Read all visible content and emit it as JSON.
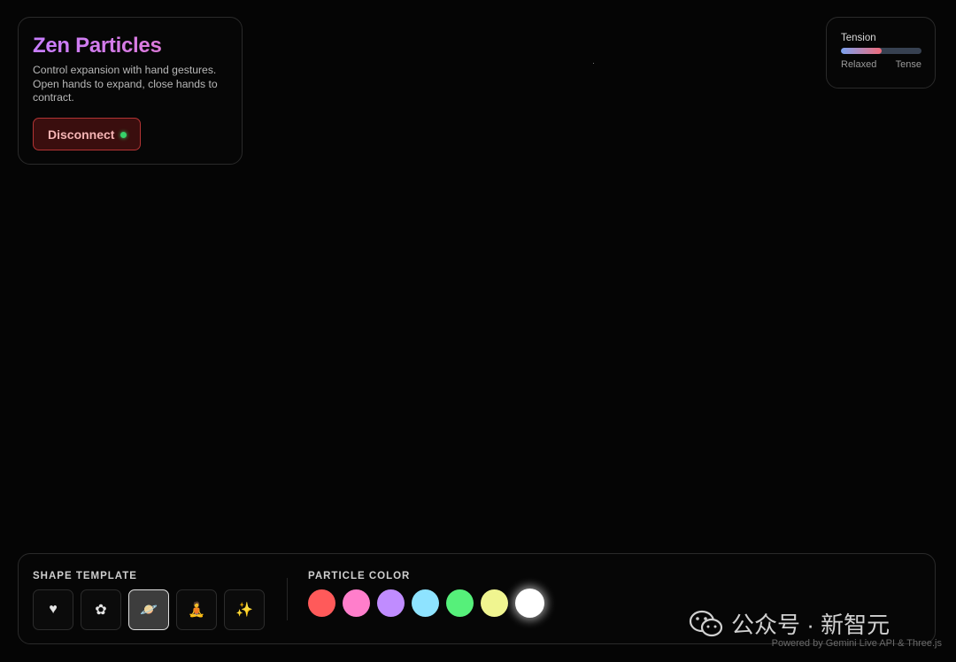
{
  "info": {
    "title": "Zen Particles",
    "description": "Control expansion with hand gestures. Open hands to expand, close hands to contract.",
    "disconnect_label": "Disconnect",
    "status_color": "#36d26a"
  },
  "tension": {
    "label": "Tension",
    "level": 0.5,
    "min_label": "Relaxed",
    "max_label": "Tense"
  },
  "controls": {
    "shape_title": "SHAPE TEMPLATE",
    "shapes": [
      {
        "name": "heart",
        "glyph": "♥",
        "active": false
      },
      {
        "name": "flower",
        "glyph": "✿",
        "active": false
      },
      {
        "name": "saturn",
        "glyph": "🪐",
        "active": true
      },
      {
        "name": "meditation",
        "glyph": "🧘",
        "active": false
      },
      {
        "name": "sparkles",
        "glyph": "✨",
        "active": false
      }
    ],
    "color_title": "PARTICLE COLOR",
    "colors": [
      {
        "name": "red",
        "hex": "#ff5a5a",
        "active": false
      },
      {
        "name": "pink",
        "hex": "#ff7ecb",
        "active": false
      },
      {
        "name": "purple",
        "hex": "#c08cff",
        "active": false
      },
      {
        "name": "cyan",
        "hex": "#8ee3ff",
        "active": false
      },
      {
        "name": "green",
        "hex": "#56f07a",
        "active": false
      },
      {
        "name": "yellow",
        "hex": "#f0f590",
        "active": false
      },
      {
        "name": "white",
        "hex": "#ffffff",
        "active": true
      }
    ]
  },
  "watermark": {
    "text": "公众号 · 新智元"
  },
  "footer": {
    "powered": "Powered by Gemini Live API & Three.js"
  }
}
